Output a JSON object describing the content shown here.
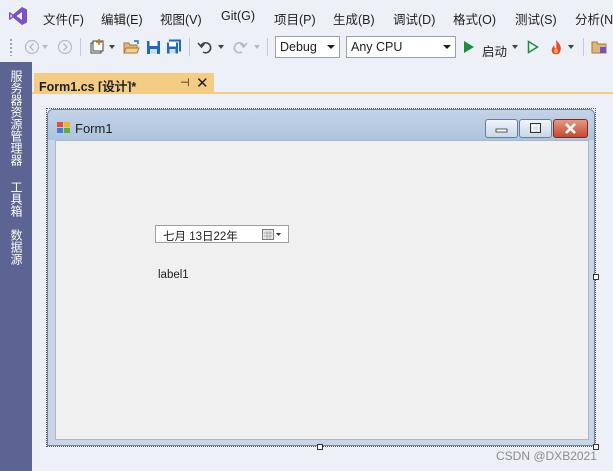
{
  "menu": {
    "items": [
      "文件(F)",
      "编辑(E)",
      "视图(V)",
      "Git(G)",
      "项目(P)",
      "生成(B)",
      "调试(D)",
      "格式(O)",
      "测试(S)",
      "分析(N"
    ]
  },
  "toolbar": {
    "config_value": "Debug",
    "platform_value": "Any CPU",
    "start_label": "启动",
    "icons": [
      "back-icon",
      "forward-icon",
      "new-project-icon",
      "open-folder-icon",
      "save-icon",
      "save-all-icon",
      "undo-icon",
      "redo-icon",
      "start-icon",
      "start-without-debug-icon",
      "hot-reload-icon",
      "solution-explorer-icon"
    ]
  },
  "sidebar": {
    "tabs": [
      "服务器资源管理器",
      "工具箱",
      "数据源"
    ]
  },
  "document_tab": {
    "title": "Form1.cs [设计]*",
    "pin": "⊣",
    "close": "✕"
  },
  "form": {
    "title": "Form1",
    "datetimepicker_value": "七月   13日22年",
    "label_text": "label1"
  },
  "watermark": "CSDN @DXB2021",
  "colors": {
    "sidebar": "#5b6492",
    "active_tab": "#f5cc84",
    "play_green": "#1e8e3e",
    "vs_purple": "#7b52c6"
  }
}
